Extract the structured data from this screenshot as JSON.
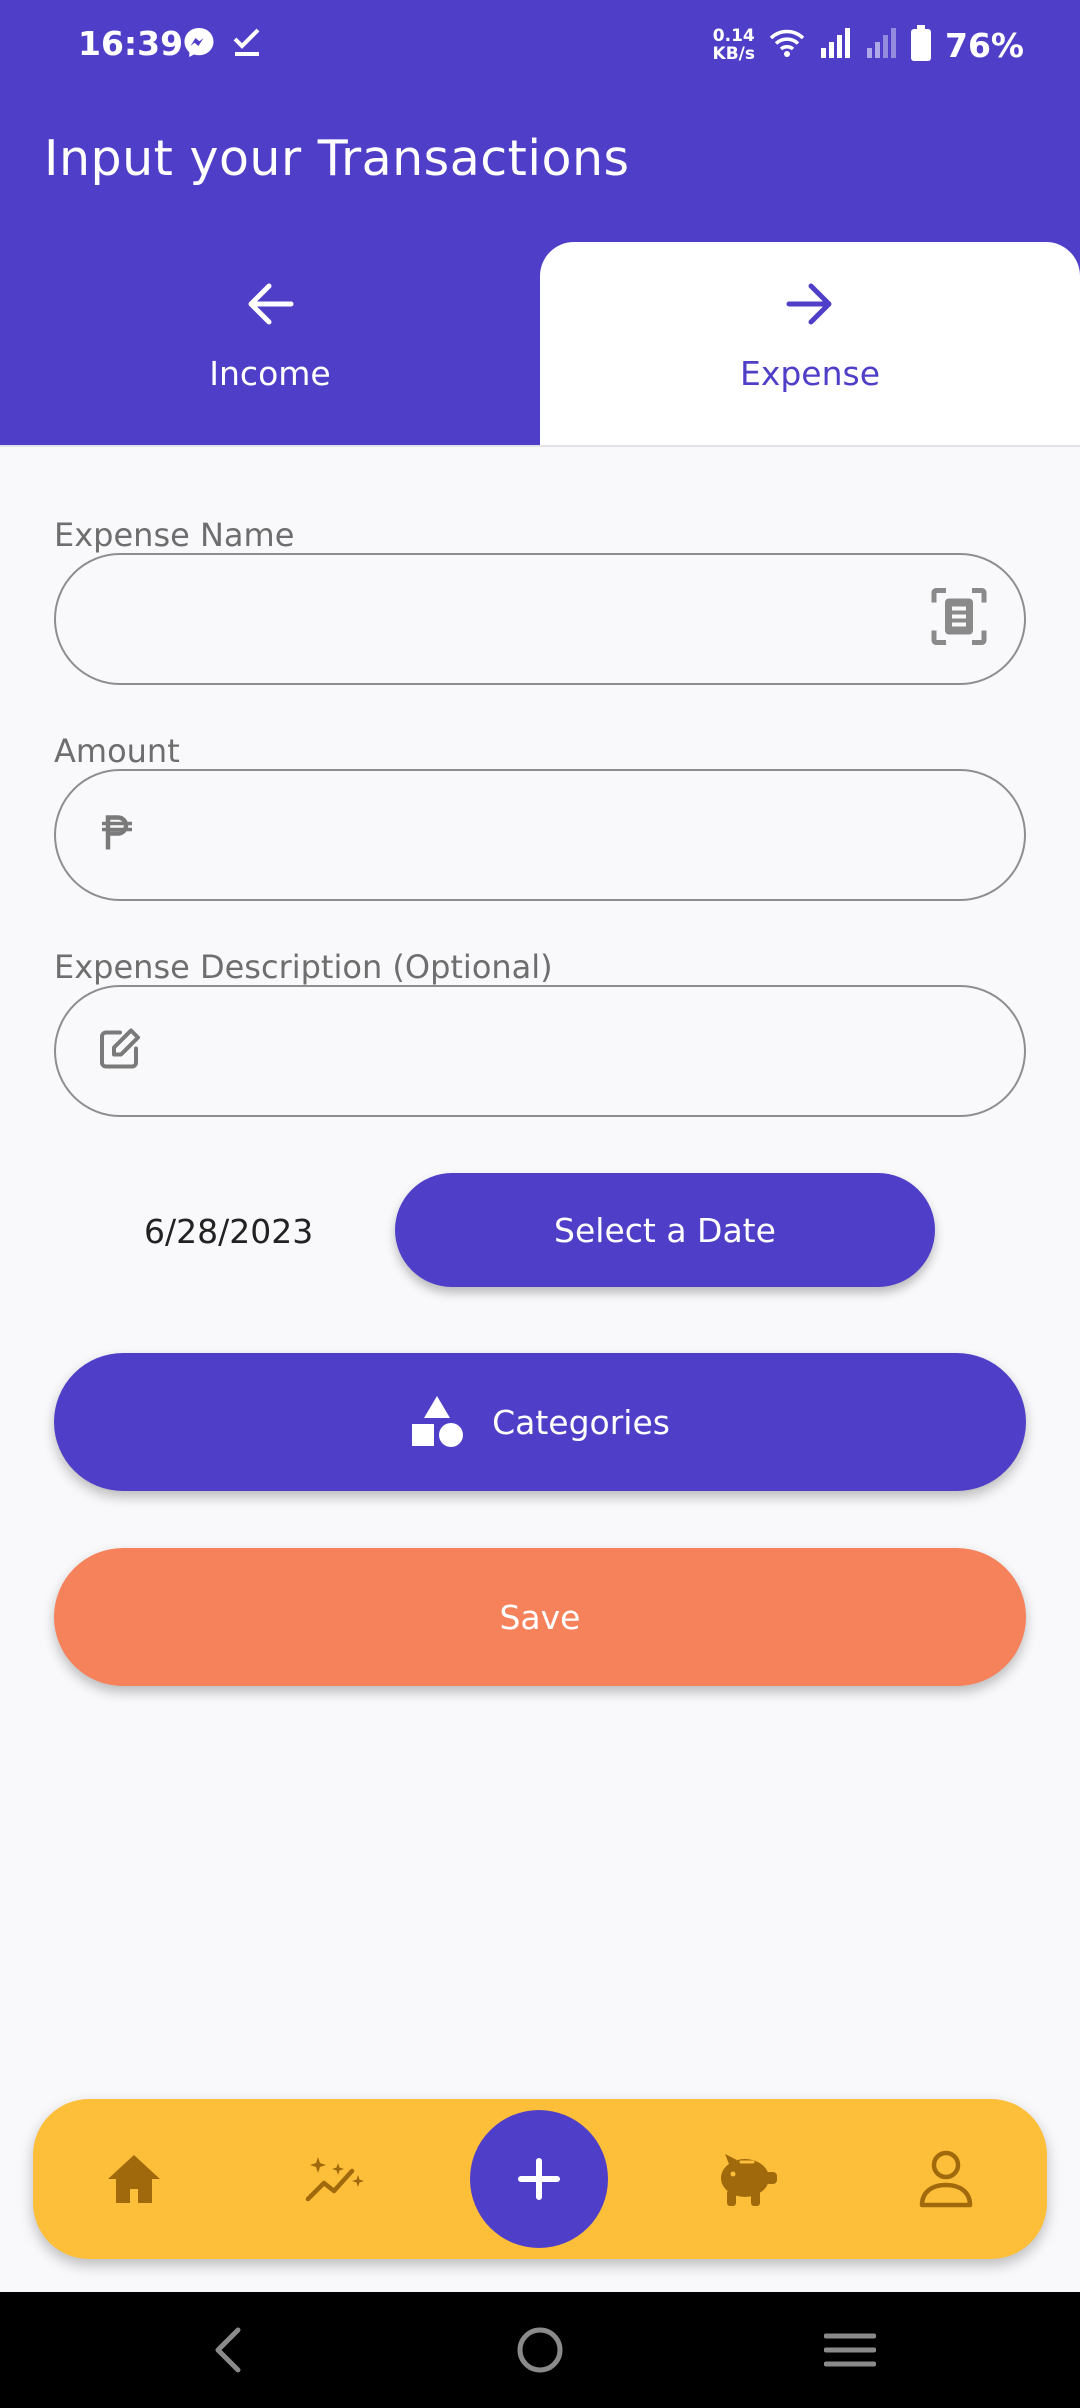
{
  "status_bar": {
    "time": "16:39",
    "net_speed_value": "0.14",
    "net_speed_unit": "KB/s",
    "battery": "76%",
    "icons": [
      "messenger-icon",
      "checkmark-icon",
      "wifi-icon",
      "signal-icon",
      "signal-weak-icon",
      "battery-icon"
    ]
  },
  "header": {
    "title": "Input your Transactions"
  },
  "tabs": [
    {
      "label": "Income",
      "icon": "arrow-left-icon",
      "selected": false
    },
    {
      "label": "Expense",
      "icon": "arrow-right-icon",
      "selected": true
    }
  ],
  "form": {
    "expense_name": {
      "label": "Expense Name",
      "value": "",
      "icon": "scan-receipt-icon"
    },
    "amount": {
      "label": "Amount",
      "value": "",
      "icon": "peso-icon"
    },
    "description": {
      "label": "Expense Description (Optional)",
      "value": "",
      "icon": "edit-icon"
    },
    "date_value": "6/28/2023",
    "select_date_label": "Select a Date",
    "categories_label": "Categories",
    "save_label": "Save"
  },
  "bottom_nav": {
    "items": [
      "home-icon",
      "sparkle-trend-icon",
      "add-icon",
      "piggy-bank-icon",
      "profile-icon"
    ]
  },
  "colors": {
    "primary": "#4f3fc8",
    "save": "#f5825b",
    "nav_bar": "#fdbf3a",
    "nav_icon": "#a06a0c"
  }
}
